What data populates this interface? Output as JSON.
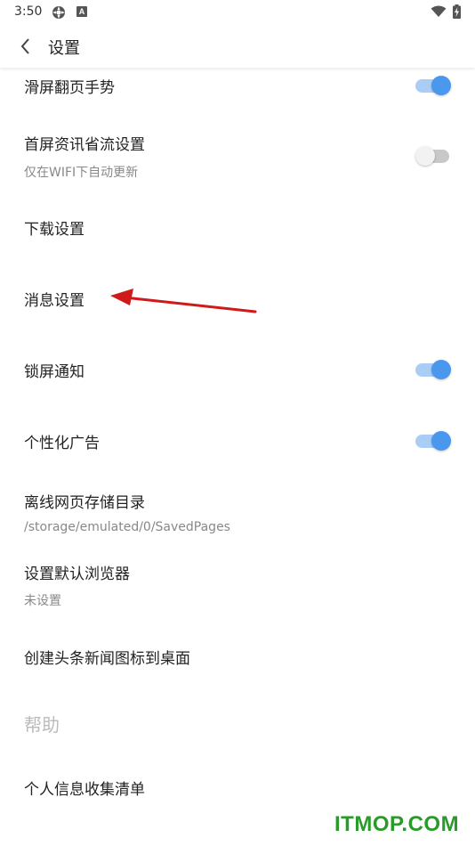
{
  "status_bar": {
    "time": "3:50",
    "icons": [
      "settings-gear-icon",
      "app-a-icon",
      "wifi-icon",
      "battery-charging-icon"
    ],
    "badge_letter": "A"
  },
  "app_bar": {
    "back_icon": "chevron-left-icon",
    "title": "设置"
  },
  "settings": {
    "swipe_gesture": {
      "title": "滑屏翻页手势",
      "enabled": true
    },
    "data_saver": {
      "title": "首屏资讯省流设置",
      "subtitle": "仅在WIFI下自动更新",
      "enabled": false
    },
    "download": {
      "title": "下载设置"
    },
    "message": {
      "title": "消息设置"
    },
    "lock_screen": {
      "title": "锁屏通知",
      "enabled": true
    },
    "personalized_ads": {
      "title": "个性化广告",
      "enabled": true
    },
    "offline_dir": {
      "title": "离线网页存储目录",
      "subtitle": "/storage/emulated/0/SavedPages"
    },
    "default_browser": {
      "title": "设置默认浏览器",
      "subtitle": "未设置"
    },
    "desktop_shortcut": {
      "title": "创建头条新闻图标到桌面"
    },
    "help_section": {
      "title": "帮助"
    },
    "personal_info": {
      "title": "个人信息收集清单"
    }
  },
  "colors": {
    "toggle_on": "#4a97ee",
    "toggle_on_track": "#a9cdf5",
    "toggle_off_track": "#c8c8c8",
    "annotation_arrow": "#d01a1a",
    "watermark": "#2a9a2a"
  },
  "watermark": "ITMOP.COM"
}
